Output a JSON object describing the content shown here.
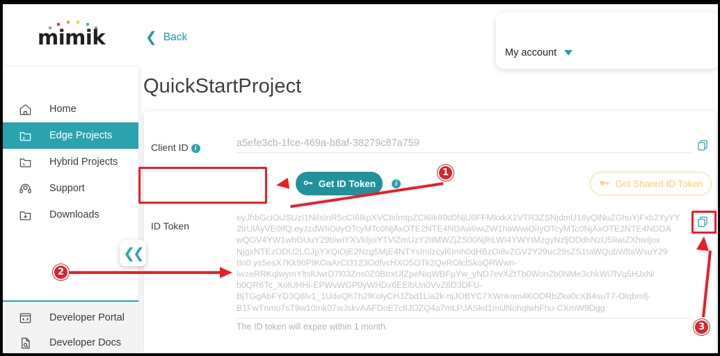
{
  "brand": {
    "logo_text": "mimik",
    "logo_dot_colors": [
      "#9e9e9e",
      "#ee3124",
      "#f7941e",
      "#ffd200",
      "#27bdbe",
      "#9e9e9e"
    ]
  },
  "header": {
    "back_label": "Back",
    "back_icon": "chevron-left-icon",
    "account_label": "My account",
    "account_caret_icon": "caret-down-icon"
  },
  "page": {
    "title": "QuickStartProject"
  },
  "sidebar": {
    "items": [
      {
        "label": "Home",
        "icon": "home-icon",
        "active": false
      },
      {
        "label": "Edge Projects",
        "icon": "folder-e-icon",
        "active": true
      },
      {
        "label": "Hybrid Projects",
        "icon": "folder-h-icon",
        "active": false
      },
      {
        "label": "Support",
        "icon": "headset-icon",
        "active": false
      },
      {
        "label": "Downloads",
        "icon": "folder-download-icon",
        "active": false
      }
    ],
    "footer_items": [
      {
        "label": "Developer Portal",
        "icon": "code-window-icon"
      },
      {
        "label": "Developer Docs",
        "icon": "doc-search-icon"
      }
    ],
    "collapse_icon": "double-chevron-left-icon"
  },
  "main": {
    "client_id": {
      "label": "Client ID",
      "info_icon": "info-icon",
      "value": "a5efe3cb-1fce-469a-b8af-38279c87a759",
      "copy_icon": "copy-icon"
    },
    "get_id_token_button": {
      "label": "Get ID Token",
      "icon": "key-icon",
      "info_icon": "info-icon"
    },
    "get_shared_id_token_button": {
      "label": "Get Shared ID Token",
      "icon": "key-icon"
    },
    "id_token": {
      "label": "ID Token",
      "copy_icon": "copy-icon",
      "hint": "The ID token will expire within 1 month.",
      "lines": [
        "eyJhbGciOiJSUzI1NiIsInR5cCI6IkpXVCIsImtpZCI6Ik80d0NjU0FFMkxkX1VTR3ZSNjdmU18yQlNuZGhuYjFxb2YyYY",
        "2trUlAyVE0ifQ.eyJzdWIiOiIyOTcyMTc0NjAxOTE2NTE4NDAwIiwiZW1haWwiOiIyOTcyMTc0NjAxOTE2NTE4NDDA",
        "wQGV4YW1wbGUuY29tIiwiYXVkIjoiYTVlZmUzY2ItMWZjZS00NjlhLWI4YWYtMzgyNzljODdhNzU5IiwiZXhwIjox",
        "NjgxNTEzODU2LCJpYXQiOjE2Nzg5MjE4NTYsImlzcyI6Imh0dHBzOi8vZGV2Y29uc29sZS1taWQubWltaWsuY29",
        "tIn0.ys5esX7Kk90PIKOaArCt3123OdfvcHXO5OTk2QeROlclSkoQRWwn-",
        "lwzeRRKqlwymYltslUwrD7l03Zns0Z0BtrxUfZpeNiqWBFpYw_yND7evXZtTb0Won2b0NMe3chkWi7lVq5HJxNi",
        "b0QR6Tc_XolUHHi-EPWvWGP9yWHDx6EElbUn0VvZ6D3DFU-",
        "BjTGgAbFYD3Q8lv1_1UdeQhTh2fKolyCHJZbd1Lia2k-njJOBYC7XWnkom4KODRbZka0cXB4suT7-Olqbmfj-",
        "B1FwTnmo7sT9w10mk07wJskvAAFDoE7c8JOZQ4a7mLPJASkd1mUNohqlwhFhu-CXmW9Dgg"
      ]
    }
  },
  "annotations": {
    "markers": [
      {
        "id": "1",
        "number": "1"
      },
      {
        "id": "2",
        "number": "2"
      },
      {
        "id": "3",
        "number": "3"
      }
    ],
    "highlight_color": "#ee1c24"
  }
}
